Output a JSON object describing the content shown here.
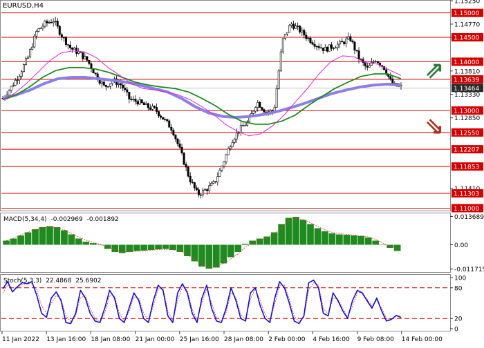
{
  "symbol_label": "EURUSD,H4",
  "colors": {
    "level": "#d40000",
    "ma_fast": "#e020e0",
    "ma_mid": "#1e8a1e",
    "ma_slow": "#8a80e8",
    "candle": "#000000",
    "macd_hist": "#1f8a1f",
    "macd_signal": "#ff3030",
    "stoch_main": "#1010cc",
    "stoch_signal": "#e03030",
    "arrow_up": "#2a7a3a",
    "arrow_down": "#a8331f",
    "price_tag": "#2a2a2a",
    "level_tag": "#d40000"
  },
  "x_axis_labels": [
    "11 Jan 2022",
    "13 Jan 16:00",
    "18 Jan 08:00",
    "21 Jan 00:00",
    "25 Jan 16:00",
    "28 Jan 08:00",
    "2 Feb 00:00",
    "4 Feb 16:00",
    "9 Feb 08:00",
    "14 Feb 00:00"
  ],
  "chart_data": [
    {
      "type": "candlestick",
      "title": "EURUSD,H4",
      "ylim": [
        1.1095,
        1.1525
      ],
      "y_tick_labels": [
        {
          "label": "1.15250",
          "value": 1.1525
        },
        {
          "label": "1.14770",
          "value": 1.1477
        },
        {
          "label": "1.14500",
          "value": 1.145
        },
        {
          "label": "1.13810",
          "value": 1.1381
        },
        {
          "label": "1.13330",
          "value": 1.1333
        },
        {
          "label": "1.12850",
          "value": 1.1285
        },
        {
          "label": "1.11410",
          "value": 1.1141
        }
      ],
      "horizontal_levels": [
        {
          "label": "1.15000",
          "value": 1.15
        },
        {
          "label": "1.14500",
          "value": 1.145
        },
        {
          "label": "1.14000",
          "value": 1.14
        },
        {
          "label": "1.13639",
          "value": 1.13639
        },
        {
          "label": "1.13000",
          "value": 1.13
        },
        {
          "label": "1.12550",
          "value": 1.1255
        },
        {
          "label": "1.12207",
          "value": 1.12207
        },
        {
          "label": "1.11853",
          "value": 1.11853
        },
        {
          "label": "1.11303",
          "value": 1.11303
        },
        {
          "label": "1.11000",
          "value": 1.11
        }
      ],
      "current_price": {
        "label": "1.13464",
        "value": 1.13464
      },
      "price_path": [
        1.1325,
        1.1348,
        1.1375,
        1.141,
        1.1462,
        1.1478,
        1.1485,
        1.1452,
        1.1428,
        1.1418,
        1.1402,
        1.1372,
        1.1348,
        1.1362,
        1.1352,
        1.1322,
        1.1318,
        1.1308,
        1.1302,
        1.1282,
        1.1262,
        1.1215,
        1.1162,
        1.1128,
        1.1138,
        1.1152,
        1.1192,
        1.1238,
        1.1262,
        1.1278,
        1.1318,
        1.1298,
        1.1298,
        1.1442,
        1.1478,
        1.1465,
        1.1448,
        1.1435,
        1.1425,
        1.1432,
        1.1438,
        1.1448,
        1.1408,
        1.1385,
        1.1405,
        1.1388,
        1.1352,
        1.1348
      ],
      "ma_fast": [
        1.1322,
        1.1335,
        1.1355,
        1.1378,
        1.1402,
        1.1418,
        1.1422,
        1.142,
        1.1408,
        1.1388,
        1.1372,
        1.1355,
        1.1345,
        1.1342,
        1.1338,
        1.1332,
        1.1322,
        1.1308,
        1.1292,
        1.1272,
        1.1258,
        1.1248,
        1.1252,
        1.1268,
        1.129,
        1.1318,
        1.1345,
        1.1375,
        1.14,
        1.1412,
        1.141,
        1.1398,
        1.1395,
        1.1383,
        1.1372
      ],
      "ma_mid": [
        1.1322,
        1.1332,
        1.1348,
        1.1368,
        1.1382,
        1.1388,
        1.1388,
        1.1385,
        1.1378,
        1.1368,
        1.1358,
        1.1352,
        1.1348,
        1.1345,
        1.1338,
        1.1325,
        1.131,
        1.1292,
        1.1278,
        1.1272,
        1.1272,
        1.1278,
        1.129,
        1.131,
        1.1328,
        1.1345,
        1.1358,
        1.137,
        1.1375,
        1.1375,
        1.1365
      ],
      "ma_slow": [
        1.1325,
        1.1332,
        1.1342,
        1.1355,
        1.1365,
        1.1368,
        1.1368,
        1.1365,
        1.1362,
        1.1358,
        1.1352,
        1.1345,
        1.1338,
        1.1325,
        1.1308,
        1.1295,
        1.1288,
        1.1286,
        1.1288,
        1.1292,
        1.1298,
        1.1306,
        1.1315,
        1.1325,
        1.1335,
        1.1342,
        1.1348,
        1.1352,
        1.1354,
        1.1352
      ],
      "arrows": [
        {
          "direction": "up",
          "symbol": "⇗"
        },
        {
          "direction": "down",
          "symbol": "⇘"
        }
      ]
    },
    {
      "type": "bar",
      "title": "MACD(5,34,4) -0.002969 -0.001892",
      "label_name": "MACD(5,34,4)",
      "label_value_1": "-0.002969",
      "label_value_2": "-0.001892",
      "ylim": [
        -0.0125,
        0.0145
      ],
      "y_tick_labels": [
        {
          "label": "0.013689",
          "value": 0.013689
        },
        {
          "label": "0.00",
          "value": 0.0
        },
        {
          "label": "-0.011715",
          "value": -0.011715
        }
      ],
      "histogram": [
        0.002,
        0.003,
        0.0045,
        0.006,
        0.0075,
        0.0085,
        0.009,
        0.0085,
        0.007,
        0.005,
        0.003,
        0.0015,
        0.0008,
        0.0,
        -0.002,
        -0.0035,
        -0.004,
        -0.0035,
        -0.003,
        -0.0028,
        -0.0025,
        -0.0022,
        -0.002,
        -0.0025,
        -0.0035,
        -0.0055,
        -0.008,
        -0.0105,
        -0.0115,
        -0.011,
        -0.009,
        -0.006,
        -0.0035,
        0.0005,
        0.002,
        0.003,
        0.004,
        0.006,
        0.01,
        0.013,
        0.0135,
        0.012,
        0.01,
        0.008,
        0.0065,
        0.0055,
        0.005,
        0.0048,
        0.0045,
        0.0042,
        0.0035,
        0.002,
        0.0,
        -0.0015,
        -0.003
      ],
      "signal": [
        0.002,
        0.0032,
        0.0048,
        0.0062,
        0.0074,
        0.0082,
        0.0086,
        0.0083,
        0.0072,
        0.0056,
        0.0038,
        0.0022,
        0.0012,
        0.0002,
        -0.0012,
        -0.0026,
        -0.0034,
        -0.0034,
        -0.0031,
        -0.0029,
        -0.0026,
        -0.0023,
        -0.0022,
        -0.0024,
        -0.0032,
        -0.0048,
        -0.007,
        -0.0092,
        -0.0105,
        -0.0104,
        -0.009,
        -0.0068,
        -0.0044,
        -0.0012,
        0.0008,
        0.0022,
        0.0034,
        0.0052,
        0.0085,
        0.0115,
        0.0128,
        0.0122,
        0.0106,
        0.0088,
        0.0072,
        0.006,
        0.0054,
        0.005,
        0.0047,
        0.0044,
        0.0038,
        0.0026,
        0.0008,
        -0.001,
        -0.0019
      ]
    },
    {
      "type": "line",
      "title": "Stoch(5,3,3) 22.4868 25.6902",
      "label_name": "Stoch(5,3,3)",
      "label_value_1": "22.4868",
      "label_value_2": "25.6902",
      "ylim": [
        0,
        100
      ],
      "levels": [
        80,
        20
      ],
      "y_tick_labels": [
        {
          "label": "100",
          "value": 100
        },
        {
          "label": "80",
          "value": 80
        },
        {
          "label": "20",
          "value": 20
        },
        {
          "label": "0",
          "value": 0
        }
      ],
      "main": [
        78,
        92,
        72,
        82,
        90,
        88,
        92,
        65,
        30,
        22,
        60,
        72,
        55,
        12,
        10,
        30,
        75,
        60,
        30,
        15,
        12,
        40,
        75,
        60,
        20,
        12,
        40,
        70,
        55,
        20,
        12,
        55,
        85,
        75,
        25,
        12,
        70,
        88,
        70,
        30,
        12,
        60,
        85,
        40,
        15,
        12,
        40,
        80,
        55,
        20,
        15,
        70,
        80,
        45,
        20,
        12,
        60,
        92,
        80,
        50,
        15,
        10,
        25,
        90,
        95,
        80,
        30,
        25,
        70,
        55,
        35,
        20,
        55,
        75,
        70,
        55,
        40,
        60,
        35,
        15,
        18,
        26,
        22
      ],
      "signal": [
        70,
        85,
        80,
        80,
        86,
        88,
        88,
        75,
        45,
        30,
        50,
        65,
        58,
        25,
        14,
        25,
        60,
        65,
        40,
        20,
        14,
        30,
        65,
        65,
        30,
        15,
        32,
        62,
        60,
        30,
        16,
        45,
        78,
        78,
        35,
        16,
        55,
        82,
        75,
        38,
        18,
        50,
        78,
        50,
        22,
        14,
        32,
        70,
        62,
        28,
        18,
        58,
        78,
        55,
        28,
        15,
        48,
        85,
        85,
        58,
        24,
        14,
        22,
        75,
        90,
        85,
        40,
        28,
        60,
        58,
        40,
        24,
        45,
        70,
        72,
        58,
        44,
        56,
        40,
        20,
        18,
        24,
        25
      ]
    }
  ]
}
